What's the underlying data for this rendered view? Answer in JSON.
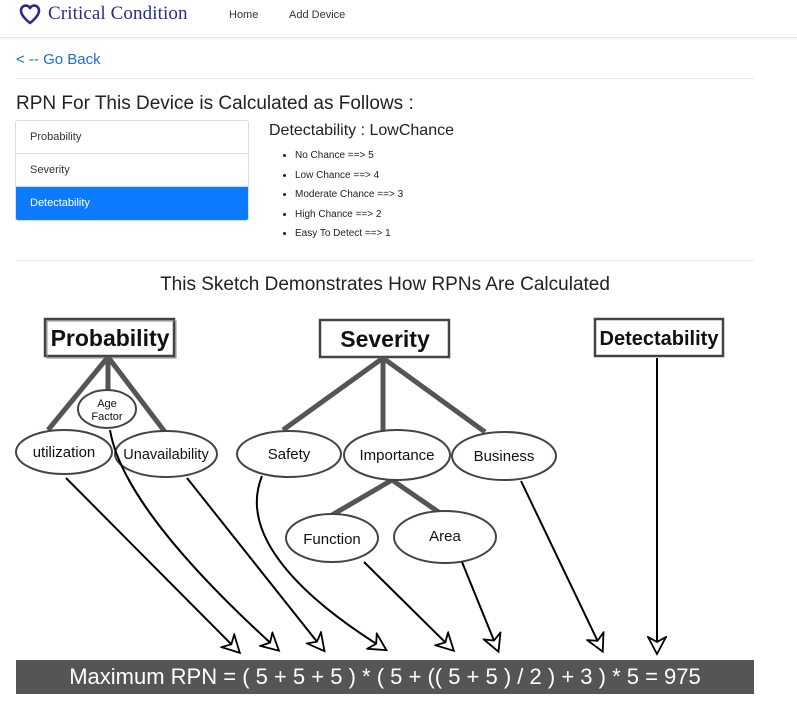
{
  "brand": {
    "name": "Critical Condition",
    "icon": "heart-outline-icon",
    "color": "#2b2b8e"
  },
  "nav": {
    "home": "Home",
    "add_device": "Add Device"
  },
  "back_link": "< -- Go Back",
  "page_heading": "RPN For This Device is Calculated as Follows :",
  "factors": [
    {
      "label": "Probability",
      "active": false
    },
    {
      "label": "Severity",
      "active": false
    },
    {
      "label": "Detectability",
      "active": true
    }
  ],
  "detail": {
    "title": "Detectability : LowChance",
    "items": [
      "No Chance ==> 5",
      "Low Chance ==> 4",
      "Moderate Chance ==> 3",
      "High Chance ==> 2",
      "Easy To Detect ==> 1"
    ]
  },
  "sketch": {
    "title": "This Sketch Demonstrates How RPNs Are Calculated",
    "boxes": {
      "probability": "Probability",
      "severity": "Severity",
      "detectability": "Detectability"
    },
    "nodes": {
      "age_factor_line1": "Age",
      "age_factor_line2": "Factor",
      "utilization": "utilization",
      "unavailability": "Unavailability",
      "safety": "Safety",
      "importance": "Importance",
      "business": "Business",
      "function": "Function",
      "area": "Area"
    },
    "formula": "Maximum RPN = ( 5 + 5 + 5 ) * ( 5 + (( 5 + 5 ) / 2 ) + 3 ) * 5 = 975"
  },
  "colors": {
    "accent": "#0d7bff",
    "link": "#1a6fd4",
    "formula_bg": "#555555"
  }
}
